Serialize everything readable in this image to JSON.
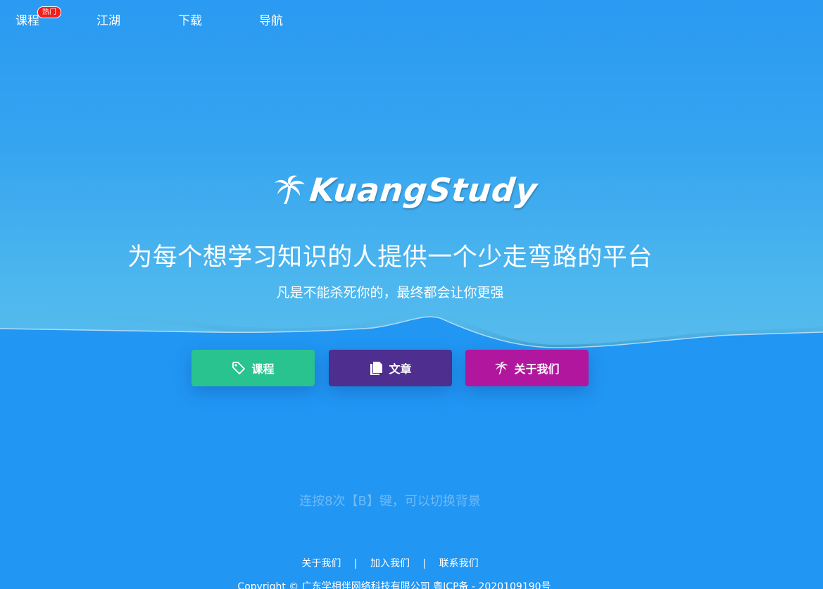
{
  "nav": {
    "items": [
      {
        "label": "课程",
        "badge": "热门"
      },
      {
        "label": "江湖"
      },
      {
        "label": "下载"
      },
      {
        "label": "导航"
      }
    ]
  },
  "hero": {
    "logo_text": "KuangStudy",
    "logo_icon": "palm-tree-icon",
    "slogan": "为每个想学习知识的人提供一个少走弯路的平台",
    "subslogan": "凡是不能杀死你的，最终都会让你更强"
  },
  "buttons": [
    {
      "label": "课程",
      "icon": "tag-icon",
      "color": "#29c38f"
    },
    {
      "label": "文章",
      "icon": "document-icon",
      "color": "#4e2e8e"
    },
    {
      "label": "关于我们",
      "icon": "palm-tree-icon",
      "color": "#b0179e"
    }
  ],
  "hint": "连按8次【B】键，可以切换背景",
  "footer": {
    "links": [
      "关于我们",
      "加入我们",
      "联系我们"
    ],
    "separator": "|",
    "copyright": "Copyright © 广东学相伴网络科技有限公司   粤ICP备 - 2020109190号"
  },
  "colors": {
    "background": "#2196f3",
    "course_button": "#29c38f",
    "article_button": "#4e2e8e",
    "about_button": "#b0179e",
    "badge": "#f0201c"
  }
}
